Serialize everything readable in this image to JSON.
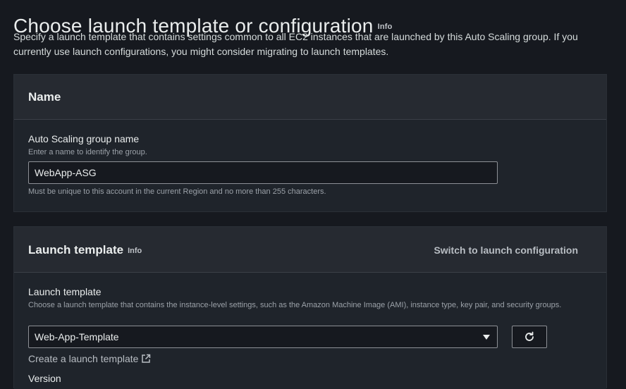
{
  "header": {
    "title": "Choose launch template or configuration",
    "info": "Info",
    "description": "Specify a launch template that contains settings common to all EC2 instances that are launched by this Auto Scaling group. If you currently use launch configurations, you might consider migrating to launch templates."
  },
  "name_panel": {
    "title": "Name",
    "field_label": "Auto Scaling group name",
    "field_hint": "Enter a name to identify the group.",
    "field_value": "WebApp-ASG",
    "field_constraint": "Must be unique to this account in the current Region and no more than 255 characters."
  },
  "launch_panel": {
    "title": "Launch template",
    "info": "Info",
    "switch_label": "Switch to launch configuration",
    "field_label": "Launch template",
    "field_hint": "Choose a launch template that contains the instance-level settings, such as the Amazon Machine Image (AMI), instance type, key pair, and security groups.",
    "selected_template": "Web-App-Template",
    "create_link": "Create a launch template",
    "next_label": "Version"
  },
  "icons": {
    "refresh": "refresh-icon",
    "external": "external-link-icon",
    "dropdown": "caret-down-icon"
  }
}
